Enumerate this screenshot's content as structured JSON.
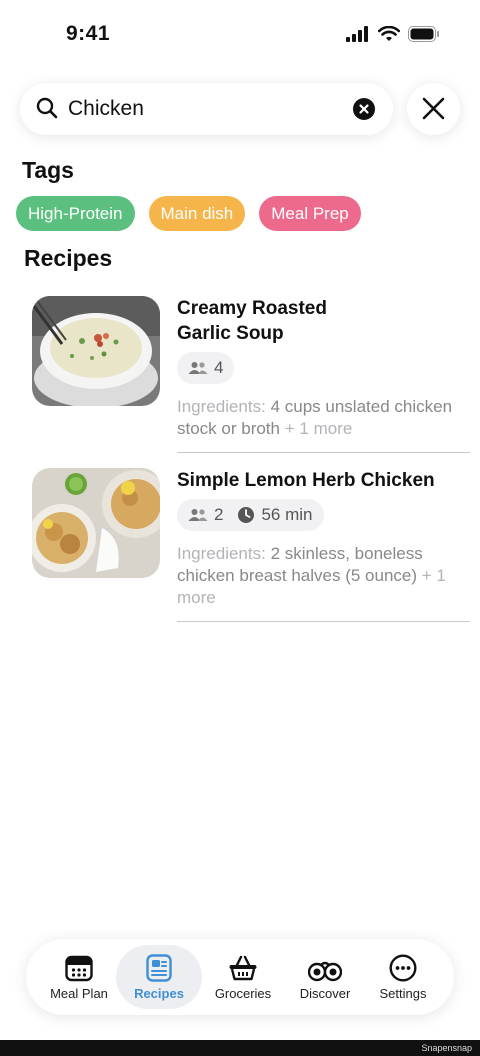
{
  "status_bar": {
    "time": "9:41"
  },
  "search": {
    "value": "Chicken",
    "placeholder": ""
  },
  "tags_section": {
    "title": "Tags",
    "items": [
      {
        "label": "High-Protein",
        "color": "#5bc07f"
      },
      {
        "label": "Main dish",
        "color": "#f5b54a"
      },
      {
        "label": "Meal Prep",
        "color": "#ee6a8c"
      }
    ]
  },
  "recipes_section": {
    "title": "Recipes",
    "items": [
      {
        "title_line1": "Creamy Roasted",
        "title_line2": "Garlic Soup",
        "servings": "4",
        "time": "",
        "ingredients_label": "Ingredients:",
        "ingredients_value": "4 cups unslated chicken stock or broth",
        "more": "+ 1 more"
      },
      {
        "title_line1": "Simple Lemon Herb Chicken",
        "title_line2": "",
        "servings": "2",
        "time": "56 min",
        "ingredients_label": "Ingredients:",
        "ingredients_value": "2 skinless, boneless chicken breast halves (5 ounce)",
        "more": "+ 1 more"
      }
    ]
  },
  "tabbar": {
    "items": [
      {
        "label": "Meal Plan",
        "icon": "calendar-icon"
      },
      {
        "label": "Recipes",
        "icon": "recipe-book-icon"
      },
      {
        "label": "Groceries",
        "icon": "basket-icon"
      },
      {
        "label": "Discover",
        "icon": "binoculars-icon"
      },
      {
        "label": "Settings",
        "icon": "more-icon"
      }
    ],
    "active_color": "#3f8fd6"
  },
  "watermark": "Snapensnap"
}
